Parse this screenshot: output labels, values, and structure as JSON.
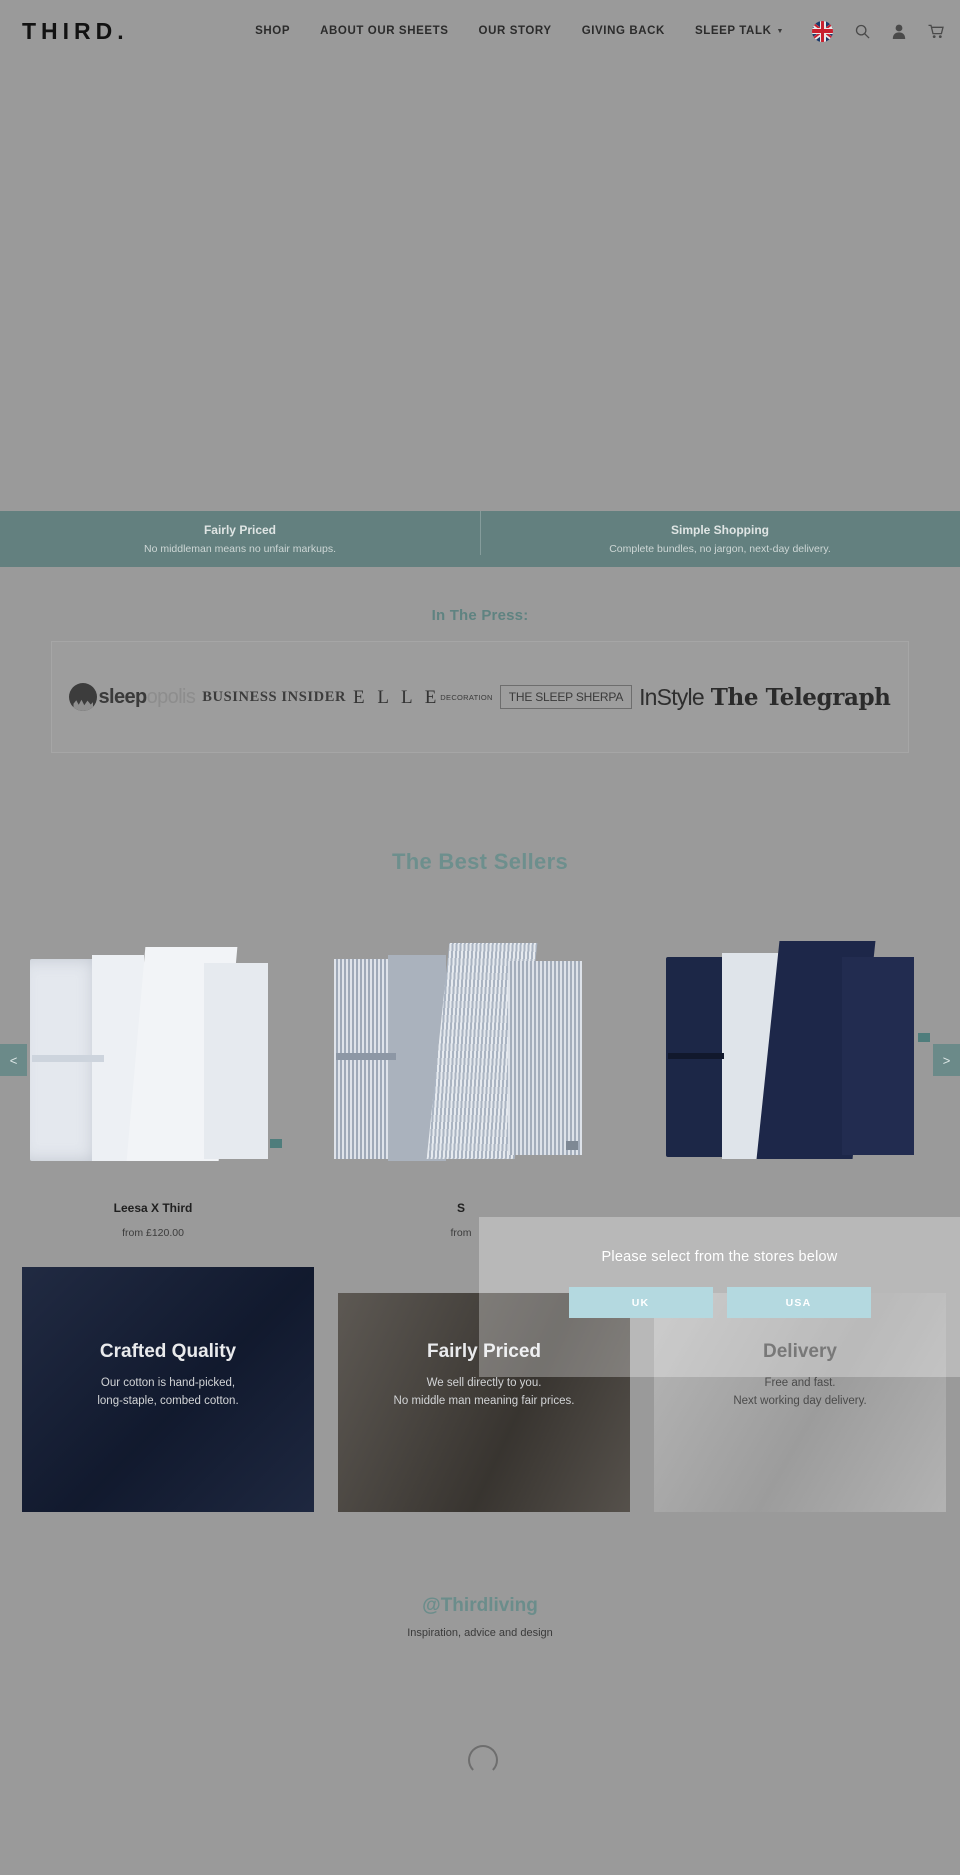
{
  "header": {
    "logo": "THIRD.",
    "nav": [
      {
        "label": "SHOP",
        "has_caret": false
      },
      {
        "label": "ABOUT OUR SHEETS",
        "has_caret": false
      },
      {
        "label": "OUR STORY",
        "has_caret": false
      },
      {
        "label": "GIVING BACK",
        "has_caret": false
      },
      {
        "label": "SLEEP TALK",
        "has_caret": true
      }
    ],
    "caret": "▼",
    "icons": {
      "flag": "uk-flag-icon",
      "search": "search-icon",
      "account": "user-account-icon",
      "cart": "shopping-cart-icon"
    }
  },
  "value_bar": {
    "background": "#63807f",
    "columns": [
      {
        "title": "Fairly Priced",
        "subtitle": "No middleman means no unfair markups."
      },
      {
        "title": "Simple Shopping",
        "subtitle": "Complete bundles, no jargon, next-day delivery."
      }
    ]
  },
  "press": {
    "heading": "In The Press:",
    "logos": [
      {
        "name": "sleepopolis",
        "text_bold": "sleep",
        "text_light": "opolis"
      },
      {
        "name": "business-insider",
        "text": "BUSINESS INSIDER"
      },
      {
        "name": "elle-decoration",
        "top": "E L L E",
        "bottom": "DECORATION"
      },
      {
        "name": "the-sleep-sherpa",
        "text": "THE SLEEP SHERPA"
      },
      {
        "name": "instyle",
        "text": "InStyle"
      },
      {
        "name": "the-telegraph",
        "text": "The Telegraph"
      }
    ]
  },
  "best_sellers": {
    "heading": "The Best Sellers",
    "accent_color": "#6d8f8d",
    "prev_label": "<",
    "next_label": ">",
    "products": [
      {
        "title": "Leesa X Third",
        "price": "from £120.00"
      },
      {
        "title": "S",
        "price": "from"
      },
      {
        "title": "",
        "price": ""
      }
    ]
  },
  "feature_cards": [
    {
      "title": "Crafted Quality",
      "line1": "Our cotton is hand-picked,",
      "line2": "long-staple, combed cotton.",
      "background": "#151f38"
    },
    {
      "title": "Fairly Priced",
      "line1": "We sell directly to you.",
      "line2": "No middle man meaning fair prices.",
      "background": "#4b4640"
    },
    {
      "title": "Delivery",
      "line1": "Free and fast.",
      "line2": "Next working day delivery.",
      "background": "#a6a6a6"
    }
  ],
  "instagram": {
    "handle": "@Thirdliving",
    "subtitle": "Inspiration, advice and design",
    "loading_icon": "loading-spinner-icon"
  },
  "modal": {
    "title": "Please select from the stores below",
    "buttons": [
      {
        "label": "UK"
      },
      {
        "label": "USA"
      }
    ],
    "button_color": "#b4d9e0"
  }
}
